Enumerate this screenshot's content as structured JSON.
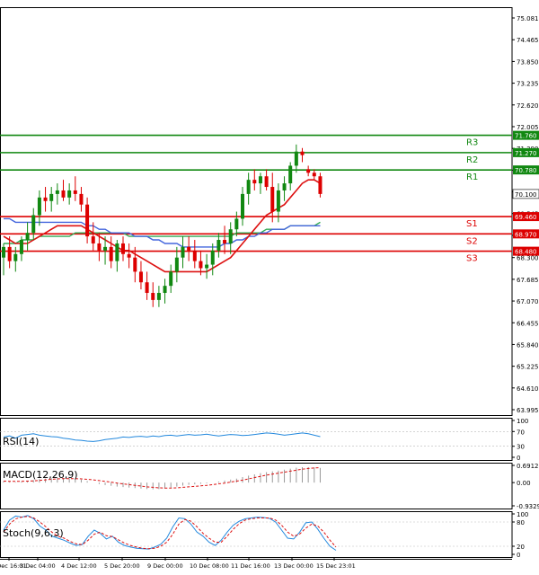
{
  "chart_data": {
    "type": "candlestick",
    "price_axis": {
      "min": 63.995,
      "max": 75.081,
      "ticks": [
        "75.081",
        "74.465",
        "73.850",
        "73.235",
        "72.620",
        "72.005",
        "71.390",
        "70.775",
        "70.160",
        "69.545",
        "68.930",
        "68.300",
        "67.685",
        "67.070",
        "66.455",
        "65.840",
        "65.225",
        "64.610",
        "63.995"
      ]
    },
    "current_price": {
      "value": 70.1,
      "label": "70.100"
    },
    "levels": [
      {
        "name": "R3",
        "value": 71.76,
        "label": "71.760",
        "kind": "resistance"
      },
      {
        "name": "R2",
        "value": 71.27,
        "label": "71.270",
        "kind": "resistance"
      },
      {
        "name": "R1",
        "value": 70.78,
        "label": "70.780",
        "kind": "resistance"
      },
      {
        "name": "S1",
        "value": 69.46,
        "label": "69.460",
        "kind": "support"
      },
      {
        "name": "S2",
        "value": 68.97,
        "label": "68.970",
        "kind": "support"
      },
      {
        "name": "S3",
        "value": 68.48,
        "label": "68.480",
        "kind": "support"
      }
    ],
    "time_labels": [
      "2 Dec 16:01",
      "3 Dec 04:00",
      "4 Dec 12:00",
      "5 Dec 20:00",
      "9 Dec 00:00",
      "10 Dec 08:00",
      "11 Dec 16:00",
      "13 Dec 00:00",
      "15 Dec 23:01"
    ],
    "candles": [
      {
        "o": 68.3,
        "h": 68.7,
        "l": 67.8,
        "c": 68.6
      },
      {
        "o": 68.6,
        "h": 68.9,
        "l": 68.0,
        "c": 68.2
      },
      {
        "o": 68.2,
        "h": 68.6,
        "l": 67.9,
        "c": 68.4
      },
      {
        "o": 68.4,
        "h": 68.9,
        "l": 68.2,
        "c": 68.8
      },
      {
        "o": 68.8,
        "h": 69.3,
        "l": 68.5,
        "c": 69.0
      },
      {
        "o": 69.0,
        "h": 69.7,
        "l": 68.8,
        "c": 69.5
      },
      {
        "o": 69.5,
        "h": 70.2,
        "l": 69.2,
        "c": 70.0
      },
      {
        "o": 70.0,
        "h": 70.3,
        "l": 69.6,
        "c": 69.9
      },
      {
        "o": 69.9,
        "h": 70.3,
        "l": 69.6,
        "c": 70.1
      },
      {
        "o": 70.1,
        "h": 70.4,
        "l": 69.8,
        "c": 70.2
      },
      {
        "o": 70.2,
        "h": 70.5,
        "l": 69.9,
        "c": 70.0
      },
      {
        "o": 70.0,
        "h": 70.4,
        "l": 69.8,
        "c": 70.2
      },
      {
        "o": 70.2,
        "h": 70.6,
        "l": 69.9,
        "c": 70.1
      },
      {
        "o": 70.1,
        "h": 70.3,
        "l": 69.6,
        "c": 69.8
      },
      {
        "o": 69.8,
        "h": 70.0,
        "l": 68.7,
        "c": 68.9
      },
      {
        "o": 68.9,
        "h": 69.3,
        "l": 68.5,
        "c": 68.7
      },
      {
        "o": 68.7,
        "h": 69.0,
        "l": 68.2,
        "c": 68.5
      },
      {
        "o": 68.5,
        "h": 68.9,
        "l": 68.1,
        "c": 68.6
      },
      {
        "o": 68.6,
        "h": 68.9,
        "l": 68.0,
        "c": 68.2
      },
      {
        "o": 68.2,
        "h": 68.8,
        "l": 67.9,
        "c": 68.7
      },
      {
        "o": 68.7,
        "h": 68.9,
        "l": 68.2,
        "c": 68.4
      },
      {
        "o": 68.4,
        "h": 68.7,
        "l": 68.0,
        "c": 68.3
      },
      {
        "o": 68.3,
        "h": 68.6,
        "l": 67.6,
        "c": 67.9
      },
      {
        "o": 67.9,
        "h": 68.2,
        "l": 67.4,
        "c": 67.6
      },
      {
        "o": 67.6,
        "h": 67.9,
        "l": 67.1,
        "c": 67.3
      },
      {
        "o": 67.3,
        "h": 67.6,
        "l": 66.9,
        "c": 67.1
      },
      {
        "o": 67.1,
        "h": 67.5,
        "l": 66.9,
        "c": 67.3
      },
      {
        "o": 67.3,
        "h": 67.7,
        "l": 67.0,
        "c": 67.5
      },
      {
        "o": 67.5,
        "h": 68.1,
        "l": 67.3,
        "c": 67.9
      },
      {
        "o": 67.9,
        "h": 68.6,
        "l": 67.6,
        "c": 68.3
      },
      {
        "o": 68.3,
        "h": 68.9,
        "l": 68.0,
        "c": 68.6
      },
      {
        "o": 68.6,
        "h": 68.9,
        "l": 68.2,
        "c": 68.5
      },
      {
        "o": 68.5,
        "h": 68.8,
        "l": 68.0,
        "c": 68.2
      },
      {
        "o": 68.2,
        "h": 68.5,
        "l": 67.8,
        "c": 68.0
      },
      {
        "o": 68.0,
        "h": 68.4,
        "l": 67.7,
        "c": 68.1
      },
      {
        "o": 68.1,
        "h": 68.7,
        "l": 67.8,
        "c": 68.5
      },
      {
        "o": 68.5,
        "h": 69.0,
        "l": 68.3,
        "c": 68.8
      },
      {
        "o": 68.8,
        "h": 69.2,
        "l": 68.4,
        "c": 68.7
      },
      {
        "o": 68.7,
        "h": 69.3,
        "l": 68.4,
        "c": 69.1
      },
      {
        "o": 69.1,
        "h": 69.6,
        "l": 68.9,
        "c": 69.4
      },
      {
        "o": 69.4,
        "h": 70.3,
        "l": 69.2,
        "c": 70.1
      },
      {
        "o": 70.1,
        "h": 70.7,
        "l": 69.8,
        "c": 70.5
      },
      {
        "o": 70.5,
        "h": 70.8,
        "l": 70.2,
        "c": 70.4
      },
      {
        "o": 70.4,
        "h": 70.7,
        "l": 70.1,
        "c": 70.6
      },
      {
        "o": 70.6,
        "h": 70.8,
        "l": 70.2,
        "c": 70.3
      },
      {
        "o": 70.3,
        "h": 70.7,
        "l": 69.3,
        "c": 69.6
      },
      {
        "o": 69.6,
        "h": 70.4,
        "l": 69.3,
        "c": 70.2
      },
      {
        "o": 70.2,
        "h": 70.6,
        "l": 69.9,
        "c": 70.4
      },
      {
        "o": 70.4,
        "h": 71.0,
        "l": 70.2,
        "c": 70.9
      },
      {
        "o": 70.9,
        "h": 71.5,
        "l": 70.7,
        "c": 71.3
      },
      {
        "o": 71.3,
        "h": 71.4,
        "l": 71.0,
        "c": 71.2
      },
      {
        "o": 70.8,
        "h": 70.9,
        "l": 70.6,
        "c": 70.7
      },
      {
        "o": 70.7,
        "h": 70.8,
        "l": 70.5,
        "c": 70.6
      },
      {
        "o": 70.6,
        "h": 70.7,
        "l": 70.0,
        "c": 70.1
      }
    ],
    "ma_red": [
      68.9,
      68.8,
      68.7,
      68.7,
      68.7,
      68.8,
      68.9,
      69.0,
      69.1,
      69.2,
      69.2,
      69.2,
      69.2,
      69.2,
      69.1,
      69.0,
      68.9,
      68.8,
      68.7,
      68.6,
      68.5,
      68.5,
      68.4,
      68.3,
      68.2,
      68.1,
      68.0,
      67.9,
      67.9,
      67.9,
      67.9,
      67.9,
      67.9,
      67.9,
      67.9,
      68.0,
      68.1,
      68.2,
      68.3,
      68.5,
      68.7,
      68.9,
      69.1,
      69.3,
      69.5,
      69.6,
      69.7,
      69.8,
      70.0,
      70.2,
      70.4,
      70.5,
      70.5,
      70.4
    ],
    "ma_blue": [
      69.4,
      69.4,
      69.3,
      69.3,
      69.3,
      69.3,
      69.3,
      69.3,
      69.3,
      69.3,
      69.3,
      69.3,
      69.3,
      69.3,
      69.2,
      69.2,
      69.1,
      69.1,
      69.0,
      69.0,
      69.0,
      69.0,
      68.9,
      68.9,
      68.9,
      68.8,
      68.8,
      68.7,
      68.7,
      68.7,
      68.6,
      68.6,
      68.6,
      68.6,
      68.6,
      68.6,
      68.6,
      68.7,
      68.7,
      68.8,
      68.8,
      68.9,
      68.9,
      69.0,
      69.0,
      69.1,
      69.1,
      69.1,
      69.2,
      69.2,
      69.2,
      69.2,
      69.2,
      69.2
    ],
    "ma_green": [
      68.7,
      68.7,
      68.7,
      68.8,
      68.8,
      68.8,
      68.9,
      68.9,
      68.9,
      68.9,
      68.9,
      68.9,
      69.0,
      69.0,
      69.0,
      69.0,
      69.0,
      69.0,
      69.0,
      69.0,
      69.0,
      68.9,
      68.9,
      68.9,
      68.9,
      68.9,
      68.9,
      68.9,
      68.9,
      68.9,
      68.9,
      68.9,
      68.9,
      68.9,
      68.9,
      68.9,
      68.9,
      68.9,
      68.9,
      69.0,
      69.0,
      69.0,
      69.0,
      69.0,
      69.1,
      69.1,
      69.1,
      69.1,
      69.2,
      69.2,
      69.2,
      69.2,
      69.2,
      69.3
    ],
    "rsi": {
      "label": "RSI(14)",
      "ticks": [
        "100",
        "70",
        "30",
        "0"
      ],
      "values": [
        55,
        58,
        52,
        60,
        62,
        64,
        60,
        58,
        56,
        55,
        52,
        50,
        47,
        46,
        44,
        43,
        45,
        48,
        50,
        52,
        55,
        54,
        56,
        57,
        55,
        58,
        56,
        59,
        60,
        58,
        60,
        62,
        60,
        61,
        63,
        60,
        58,
        60,
        62,
        61,
        59,
        60,
        62,
        64,
        66,
        65,
        63,
        60,
        62,
        64,
        66,
        64,
        60,
        56
      ]
    },
    "macd": {
      "label": "MACD(12,26,9)",
      "ticks": [
        "0.6912",
        "0.00",
        "-0.9329"
      ],
      "histogram": [
        0.05,
        0.03,
        0.02,
        0.04,
        0.06,
        0.1,
        0.14,
        0.16,
        0.18,
        0.19,
        0.18,
        0.17,
        0.15,
        0.12,
        0.06,
        0.0,
        -0.06,
        -0.1,
        -0.13,
        -0.16,
        -0.18,
        -0.2,
        -0.22,
        -0.24,
        -0.26,
        -0.27,
        -0.26,
        -0.24,
        -0.2,
        -0.16,
        -0.12,
        -0.09,
        -0.07,
        -0.05,
        -0.03,
        0.0,
        0.04,
        0.08,
        0.12,
        0.16,
        0.22,
        0.28,
        0.33,
        0.38,
        0.42,
        0.45,
        0.48,
        0.52,
        0.56,
        0.6,
        0.62,
        0.62,
        0.61,
        0.59
      ],
      "signal": [
        0.06,
        0.05,
        0.05,
        0.05,
        0.06,
        0.07,
        0.09,
        0.11,
        0.13,
        0.15,
        0.16,
        0.16,
        0.16,
        0.15,
        0.13,
        0.11,
        0.08,
        0.05,
        0.02,
        -0.02,
        -0.05,
        -0.08,
        -0.11,
        -0.14,
        -0.17,
        -0.19,
        -0.21,
        -0.22,
        -0.22,
        -0.21,
        -0.19,
        -0.17,
        -0.15,
        -0.13,
        -0.11,
        -0.08,
        -0.05,
        -0.02,
        0.02,
        0.06,
        0.1,
        0.15,
        0.2,
        0.25,
        0.3,
        0.34,
        0.38,
        0.42,
        0.46,
        0.5,
        0.54,
        0.57,
        0.59,
        0.6
      ]
    },
    "stoch": {
      "label": "Stoch(9,6,3)",
      "ticks": [
        "100",
        "80",
        "20",
        "0"
      ],
      "k": [
        60,
        85,
        95,
        92,
        96,
        88,
        70,
        60,
        45,
        40,
        35,
        28,
        22,
        24,
        45,
        60,
        52,
        38,
        45,
        30,
        22,
        18,
        15,
        14,
        13,
        18,
        25,
        40,
        68,
        90,
        88,
        75,
        55,
        45,
        30,
        22,
        35,
        55,
        72,
        82,
        88,
        90,
        92,
        91,
        89,
        80,
        60,
        40,
        38,
        55,
        78,
        80,
        62,
        40,
        20,
        10
      ],
      "d": [
        55,
        75,
        88,
        92,
        94,
        90,
        80,
        68,
        55,
        45,
        40,
        32,
        26,
        24,
        35,
        50,
        55,
        46,
        44,
        36,
        28,
        22,
        18,
        15,
        14,
        15,
        20,
        30,
        50,
        75,
        86,
        82,
        68,
        52,
        40,
        30,
        30,
        45,
        62,
        76,
        85,
        88,
        90,
        90,
        90,
        85,
        72,
        55,
        45,
        50,
        65,
        75,
        70,
        55,
        35,
        18
      ]
    }
  }
}
